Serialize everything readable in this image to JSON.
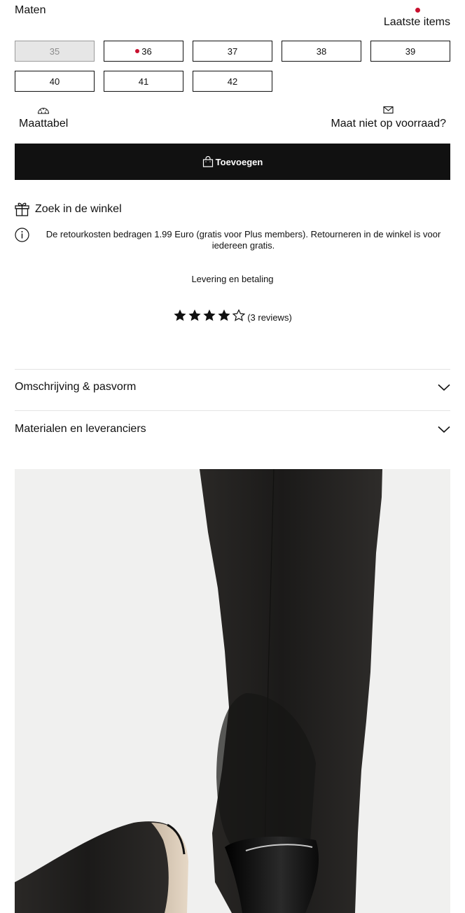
{
  "sizes": {
    "title": "Maten",
    "last_items_label": "Laatste items",
    "options": [
      {
        "label": "35",
        "state": "unavailable",
        "last_items": false
      },
      {
        "label": "36",
        "state": "available",
        "last_items": true
      },
      {
        "label": "37",
        "state": "available",
        "last_items": false
      },
      {
        "label": "38",
        "state": "available",
        "last_items": false
      },
      {
        "label": "39",
        "state": "available",
        "last_items": false
      },
      {
        "label": "40",
        "state": "available",
        "last_items": false
      },
      {
        "label": "41",
        "state": "available",
        "last_items": false
      },
      {
        "label": "42",
        "state": "available",
        "last_items": false
      }
    ]
  },
  "size_guide": {
    "label": "Maattabel",
    "icon": "ruler-icon"
  },
  "out_of_stock": {
    "label": "Maat niet op voorraad?",
    "icon": "envelope-icon"
  },
  "add_to_bag": {
    "label": "Toevoegen",
    "icon": "shopping-bag-icon"
  },
  "find_in_store": {
    "label": "Zoek in de winkel",
    "icon": "gift-icon"
  },
  "returns_info": {
    "text": "De retourkosten bedragen 1.99 Euro (gratis voor Plus members). Retourneren in de winkel is voor iedereen gratis.",
    "icon": "info-icon"
  },
  "delivery_link": "Levering en betaling",
  "rating": {
    "stars": 4,
    "max": 5,
    "count_label": "(3 reviews)"
  },
  "accordion": [
    {
      "label": "Omschrijving & pasvorm",
      "icon": "chevron-down-icon"
    },
    {
      "label": "Materialen en leveranciers",
      "icon": "chevron-down-icon"
    }
  ],
  "colors": {
    "accent": "#111111",
    "alert": "#c8102e",
    "image_bg": "#f0f0ef"
  }
}
